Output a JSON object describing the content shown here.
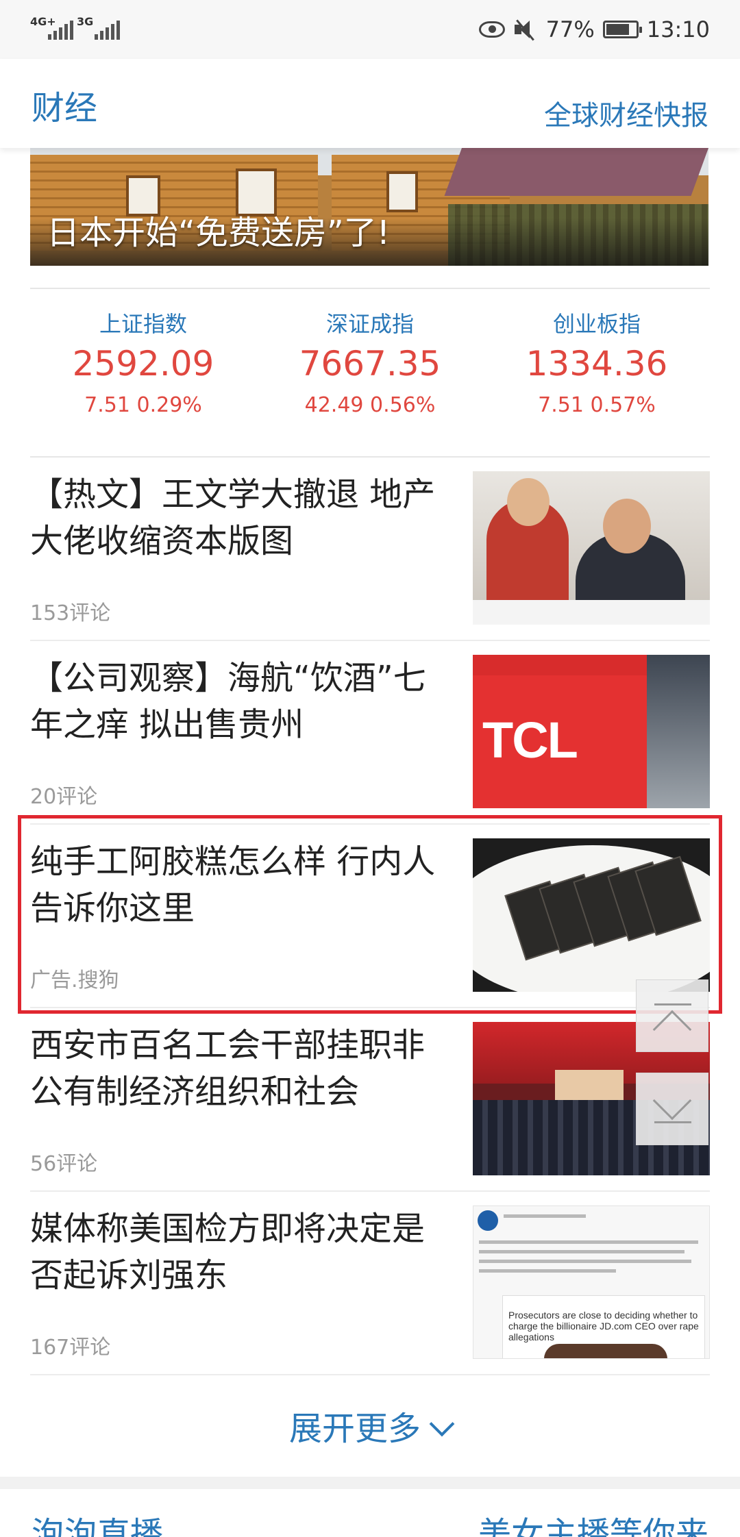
{
  "status_bar": {
    "signal1_label": "4G+",
    "signal2_label": "3G",
    "battery": "77%",
    "time": "13:10",
    "icons": [
      "eye-icon",
      "mute-icon",
      "battery-icon"
    ]
  },
  "header": {
    "title": "财经",
    "link": "全球财经快报"
  },
  "banner": {
    "caption": "日本开始“免费送房”了!"
  },
  "indices": [
    {
      "name": "上证指数",
      "value": "2592.09",
      "change": "7.51  0.29%"
    },
    {
      "name": "深证成指",
      "value": "7667.35",
      "change": "42.49  0.56%"
    },
    {
      "name": "创业板指",
      "value": "1334.36",
      "change": "7.51  0.57%"
    }
  ],
  "news": [
    {
      "title": "【热文】王文学大撤退 地产大佬收缩资本版图",
      "meta": "153评论"
    },
    {
      "title": "【公司观察】海航“饮酒”七年之痒 拟出售贵州",
      "meta": "20评论",
      "thumb_text": "TCL"
    },
    {
      "title": "纯手工阿胶糕怎么样 行内人告诉你这里",
      "meta": "广告.搜狗"
    },
    {
      "title": "西安市百名工会干部挂职非公有制经济组织和社会",
      "meta": "56评论"
    },
    {
      "title": "媒体称美国检方即将决定是否起诉刘强东",
      "meta": "167评论",
      "thumb_text": "Prosecutors are close to deciding whether to charge the billionaire JD.com CEO over rape allegations"
    }
  ],
  "expand_more": "展开更多",
  "next_section": {
    "left": "泡泡直播",
    "right": "美女主播等你来"
  },
  "colors": {
    "accent": "#2a78b8",
    "price_up": "#e0473f",
    "highlight": "#e02730"
  }
}
